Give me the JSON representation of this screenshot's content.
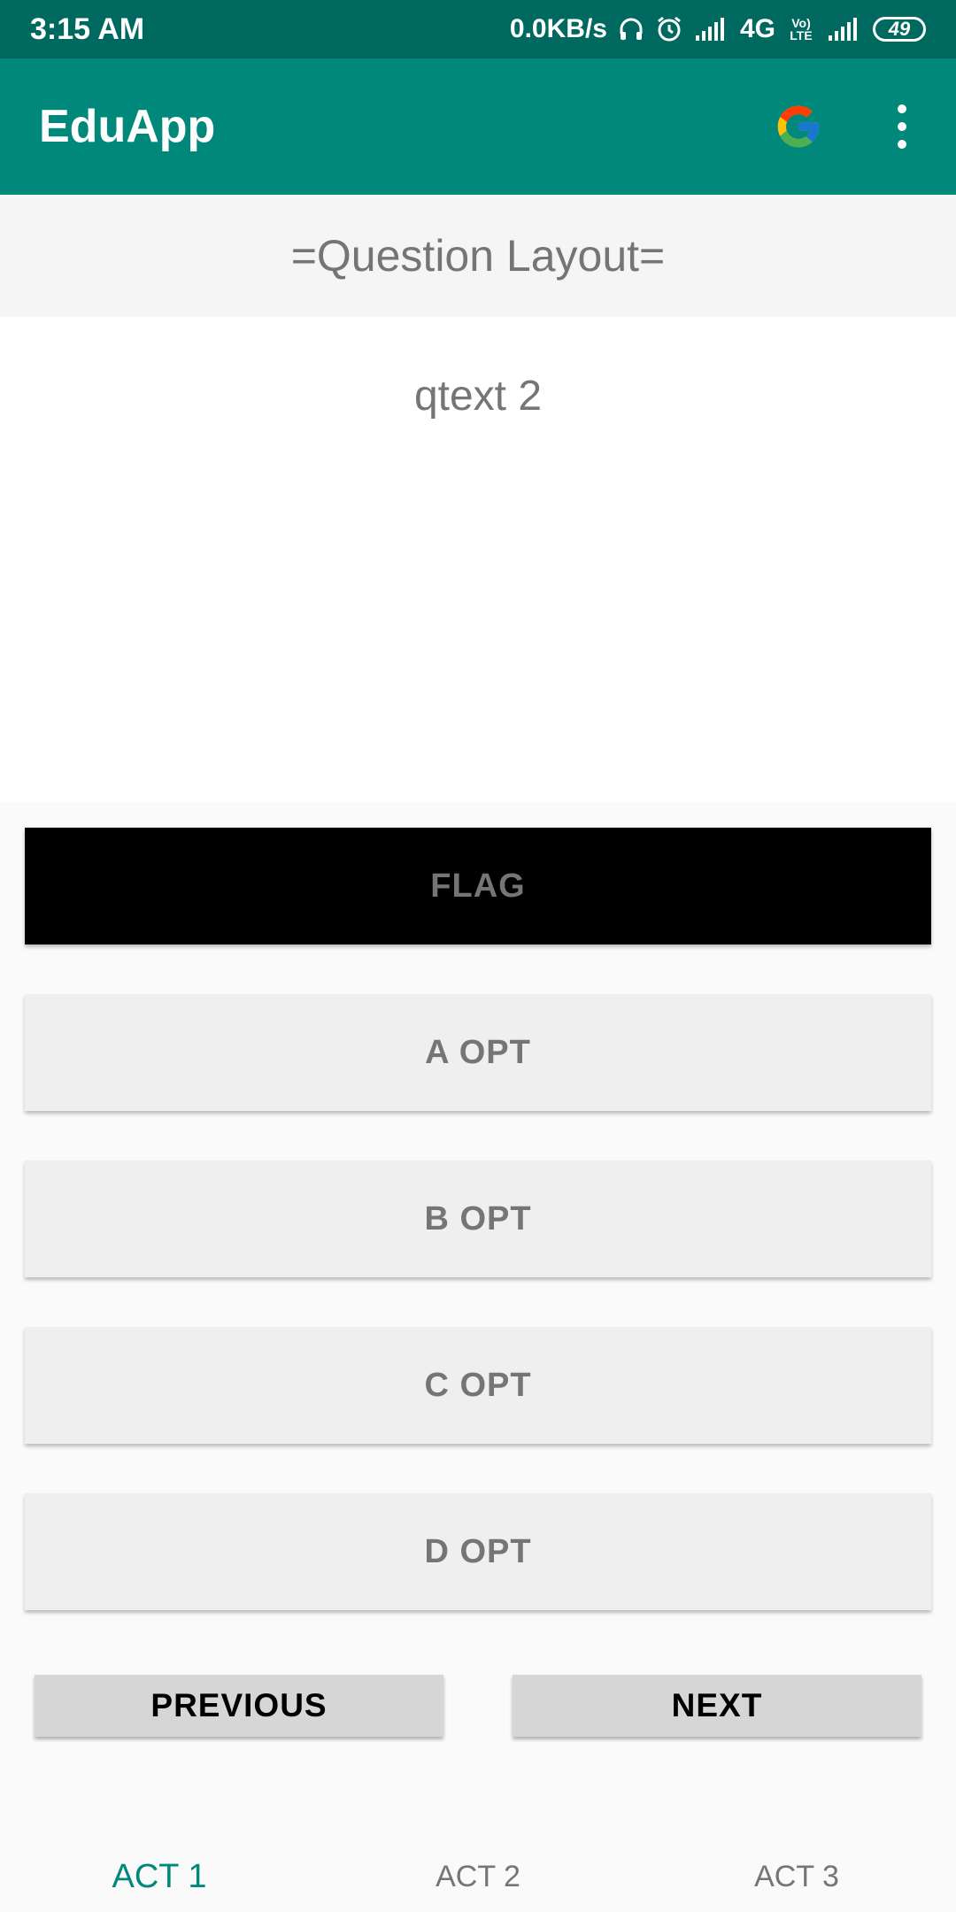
{
  "status_bar": {
    "time": "3:15 AM",
    "net_speed": "0.0KB/s",
    "network_type": "4G",
    "volte": "Vo) LTE",
    "battery": "49",
    "icons": [
      "headphones-icon",
      "alarm-icon",
      "signal-icon",
      "volte-icon",
      "signal-icon",
      "battery-icon"
    ]
  },
  "app_bar": {
    "title": "EduApp",
    "icons": [
      "google-g-icon",
      "more-vert-icon"
    ],
    "colors": {
      "app_bar": "#00897b",
      "status_bar": "#00695f"
    }
  },
  "header": {
    "title": "=Question Layout="
  },
  "question": {
    "text": "qtext 2"
  },
  "buttons": {
    "flag": "FLAG",
    "options": [
      "A OPT",
      "B OPT",
      "C OPT",
      "D OPT"
    ],
    "previous": "PREVIOUS",
    "next": "NEXT"
  },
  "tabs": [
    {
      "label": "ACT 1",
      "active": true
    },
    {
      "label": "ACT 2",
      "active": false
    },
    {
      "label": "ACT 3",
      "active": false
    }
  ]
}
